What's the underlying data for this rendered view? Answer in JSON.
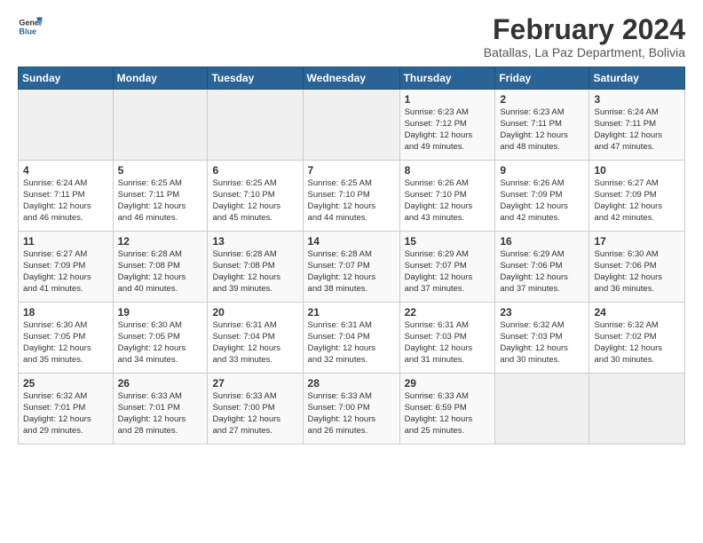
{
  "header": {
    "logo_line1": "General",
    "logo_line2": "Blue",
    "main_title": "February 2024",
    "subtitle": "Batallas, La Paz Department, Bolivia"
  },
  "days_of_week": [
    "Sunday",
    "Monday",
    "Tuesday",
    "Wednesday",
    "Thursday",
    "Friday",
    "Saturday"
  ],
  "weeks": [
    [
      {
        "day": "",
        "info": ""
      },
      {
        "day": "",
        "info": ""
      },
      {
        "day": "",
        "info": ""
      },
      {
        "day": "",
        "info": ""
      },
      {
        "day": "1",
        "info": "Sunrise: 6:23 AM\nSunset: 7:12 PM\nDaylight: 12 hours\nand 49 minutes."
      },
      {
        "day": "2",
        "info": "Sunrise: 6:23 AM\nSunset: 7:11 PM\nDaylight: 12 hours\nand 48 minutes."
      },
      {
        "day": "3",
        "info": "Sunrise: 6:24 AM\nSunset: 7:11 PM\nDaylight: 12 hours\nand 47 minutes."
      }
    ],
    [
      {
        "day": "4",
        "info": "Sunrise: 6:24 AM\nSunset: 7:11 PM\nDaylight: 12 hours\nand 46 minutes."
      },
      {
        "day": "5",
        "info": "Sunrise: 6:25 AM\nSunset: 7:11 PM\nDaylight: 12 hours\nand 46 minutes."
      },
      {
        "day": "6",
        "info": "Sunrise: 6:25 AM\nSunset: 7:10 PM\nDaylight: 12 hours\nand 45 minutes."
      },
      {
        "day": "7",
        "info": "Sunrise: 6:25 AM\nSunset: 7:10 PM\nDaylight: 12 hours\nand 44 minutes."
      },
      {
        "day": "8",
        "info": "Sunrise: 6:26 AM\nSunset: 7:10 PM\nDaylight: 12 hours\nand 43 minutes."
      },
      {
        "day": "9",
        "info": "Sunrise: 6:26 AM\nSunset: 7:09 PM\nDaylight: 12 hours\nand 42 minutes."
      },
      {
        "day": "10",
        "info": "Sunrise: 6:27 AM\nSunset: 7:09 PM\nDaylight: 12 hours\nand 42 minutes."
      }
    ],
    [
      {
        "day": "11",
        "info": "Sunrise: 6:27 AM\nSunset: 7:09 PM\nDaylight: 12 hours\nand 41 minutes."
      },
      {
        "day": "12",
        "info": "Sunrise: 6:28 AM\nSunset: 7:08 PM\nDaylight: 12 hours\nand 40 minutes."
      },
      {
        "day": "13",
        "info": "Sunrise: 6:28 AM\nSunset: 7:08 PM\nDaylight: 12 hours\nand 39 minutes."
      },
      {
        "day": "14",
        "info": "Sunrise: 6:28 AM\nSunset: 7:07 PM\nDaylight: 12 hours\nand 38 minutes."
      },
      {
        "day": "15",
        "info": "Sunrise: 6:29 AM\nSunset: 7:07 PM\nDaylight: 12 hours\nand 37 minutes."
      },
      {
        "day": "16",
        "info": "Sunrise: 6:29 AM\nSunset: 7:06 PM\nDaylight: 12 hours\nand 37 minutes."
      },
      {
        "day": "17",
        "info": "Sunrise: 6:30 AM\nSunset: 7:06 PM\nDaylight: 12 hours\nand 36 minutes."
      }
    ],
    [
      {
        "day": "18",
        "info": "Sunrise: 6:30 AM\nSunset: 7:05 PM\nDaylight: 12 hours\nand 35 minutes."
      },
      {
        "day": "19",
        "info": "Sunrise: 6:30 AM\nSunset: 7:05 PM\nDaylight: 12 hours\nand 34 minutes."
      },
      {
        "day": "20",
        "info": "Sunrise: 6:31 AM\nSunset: 7:04 PM\nDaylight: 12 hours\nand 33 minutes."
      },
      {
        "day": "21",
        "info": "Sunrise: 6:31 AM\nSunset: 7:04 PM\nDaylight: 12 hours\nand 32 minutes."
      },
      {
        "day": "22",
        "info": "Sunrise: 6:31 AM\nSunset: 7:03 PM\nDaylight: 12 hours\nand 31 minutes."
      },
      {
        "day": "23",
        "info": "Sunrise: 6:32 AM\nSunset: 7:03 PM\nDaylight: 12 hours\nand 30 minutes."
      },
      {
        "day": "24",
        "info": "Sunrise: 6:32 AM\nSunset: 7:02 PM\nDaylight: 12 hours\nand 30 minutes."
      }
    ],
    [
      {
        "day": "25",
        "info": "Sunrise: 6:32 AM\nSunset: 7:01 PM\nDaylight: 12 hours\nand 29 minutes."
      },
      {
        "day": "26",
        "info": "Sunrise: 6:33 AM\nSunset: 7:01 PM\nDaylight: 12 hours\nand 28 minutes."
      },
      {
        "day": "27",
        "info": "Sunrise: 6:33 AM\nSunset: 7:00 PM\nDaylight: 12 hours\nand 27 minutes."
      },
      {
        "day": "28",
        "info": "Sunrise: 6:33 AM\nSunset: 7:00 PM\nDaylight: 12 hours\nand 26 minutes."
      },
      {
        "day": "29",
        "info": "Sunrise: 6:33 AM\nSunset: 6:59 PM\nDaylight: 12 hours\nand 25 minutes."
      },
      {
        "day": "",
        "info": ""
      },
      {
        "day": "",
        "info": ""
      }
    ]
  ]
}
